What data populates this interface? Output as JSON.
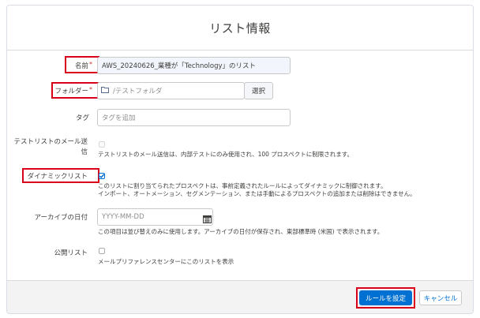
{
  "dialog": {
    "title": "リスト情報"
  },
  "form": {
    "name": {
      "label": "名前",
      "required_mark": "*",
      "value": "AWS_20240626_業種が「Technology」のリスト"
    },
    "folder": {
      "label": "フォルダー",
      "required_mark": "*",
      "placeholder": "/テストフォルダ",
      "select_label": "選択"
    },
    "tag": {
      "label": "タグ",
      "placeholder": "タグを追加"
    },
    "test_email": {
      "label_line1": "テストリストのメール送",
      "label_line2": "信",
      "help": "テストリストのメール送信は、内部テストにのみ使用され、100 プロスペクトに制限されます。",
      "checked": false
    },
    "dynamic": {
      "label": "ダイナミックリスト",
      "help_line1": "このリストに割り当てられたプロスペクトは、事前定義されたルールによってダイナミックに制御されます。",
      "help_line2": "インポート、オートメーション、セグメンテーション、または手動によるプロスペクトの追加または削除はできません。",
      "checked": true
    },
    "archive": {
      "label": "アーカイブの日付",
      "placeholder": "YYYY-MM-DD",
      "help": "この項目は並び替えのみに使用します。アーカイブの日付が保存され、東部標準時 (米国) で表示されます。"
    },
    "public": {
      "label": "公開リスト",
      "help": "メールプリファレンスセンターにこのリストを表示",
      "checked": false
    }
  },
  "footer": {
    "primary_label": "ルールを設定",
    "cancel_label": "キャンセル"
  },
  "colors": {
    "highlight": "#d9001b",
    "brand": "#0070d2"
  },
  "icons": {
    "folder": "folder-icon",
    "calendar": "calendar-icon",
    "check": "checkmark-icon"
  }
}
